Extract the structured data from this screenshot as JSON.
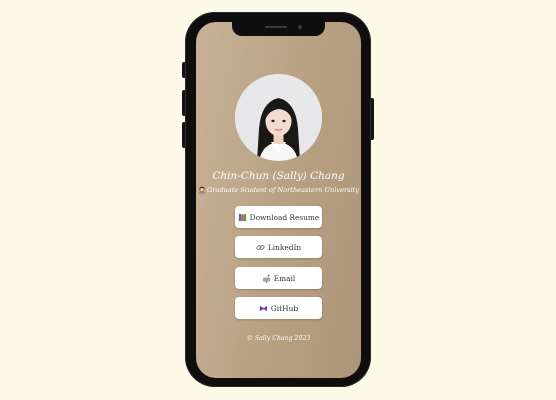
{
  "profile": {
    "name": "Chin-Chun (Sally) Chang",
    "subtitle": "Graduate Student of Northeastern University"
  },
  "links": {
    "resume": {
      "label": "Download Resume",
      "icon": "books-icon"
    },
    "linkedin": {
      "label": "LinkedIn",
      "icon": "link-icon"
    },
    "email": {
      "label": "Email",
      "icon": "mailbox-icon"
    },
    "github": {
      "label": "GitHub",
      "icon": "ribbon-bow-icon"
    }
  },
  "footer": {
    "text": "© Sally Chang 2023"
  },
  "colors": {
    "page_background": "#fdfbe8",
    "screen_gradient_start": "#c8b398",
    "screen_gradient_end": "#ad9476",
    "button_background": "#ffffff",
    "text_on_screen": "#ffffff"
  }
}
